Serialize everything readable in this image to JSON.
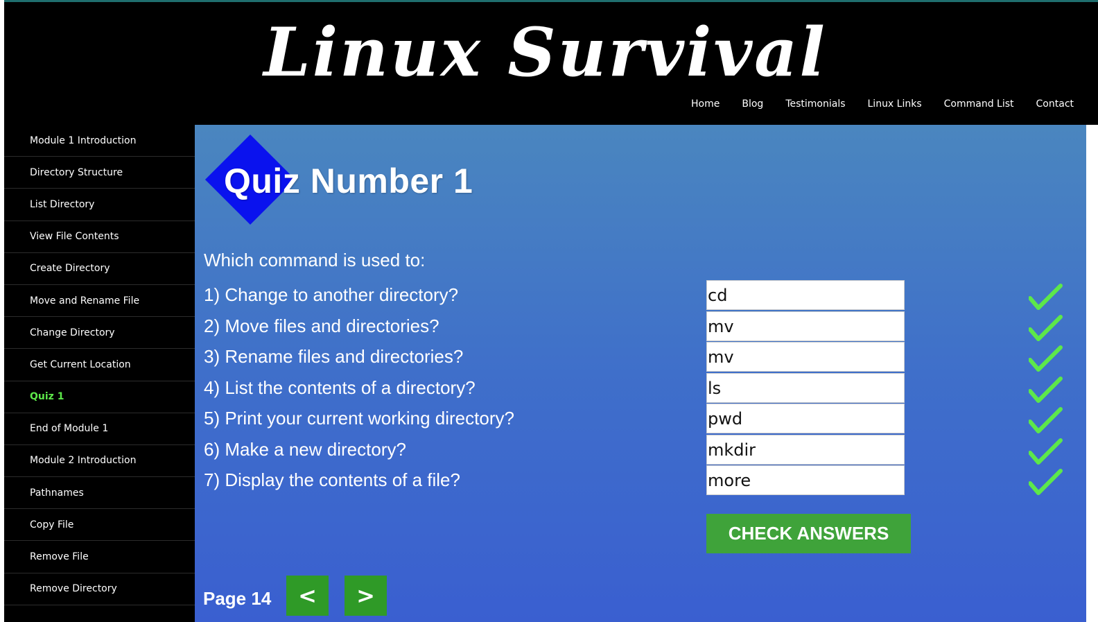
{
  "site": {
    "title": "Linux Survival"
  },
  "topnav": [
    "Home",
    "Blog",
    "Testimonials",
    "Linux Links",
    "Command List",
    "Contact"
  ],
  "sidebar": {
    "items": [
      {
        "label": "Module 1 Introduction"
      },
      {
        "label": "Directory Structure"
      },
      {
        "label": "List Directory"
      },
      {
        "label": "View File Contents"
      },
      {
        "label": "Create Directory"
      },
      {
        "label": "Move and Rename File"
      },
      {
        "label": "Change Directory"
      },
      {
        "label": "Get Current Location"
      },
      {
        "label": "Quiz 1",
        "active": true
      },
      {
        "label": "End of Module 1"
      },
      {
        "label": "Module 2 Introduction"
      },
      {
        "label": "Pathnames"
      },
      {
        "label": "Copy File"
      },
      {
        "label": "Remove File"
      },
      {
        "label": "Remove Directory"
      }
    ]
  },
  "main": {
    "quiz_title": "Quiz Number 1",
    "intro": "Which command is used to:",
    "questions": [
      {
        "text": "1) Change to another directory?",
        "answer": "cd",
        "icon": "checkmark-icon"
      },
      {
        "text": "2) Move files and directories?",
        "answer": "mv",
        "icon": "checkmark-icon"
      },
      {
        "text": "3) Rename files and directories?",
        "answer": "mv",
        "icon": "checkmark-icon"
      },
      {
        "text": "4) List the contents of a directory?",
        "answer": "ls",
        "icon": "checkmark-icon"
      },
      {
        "text": "5) Print your current working directory?",
        "answer": "pwd",
        "icon": "checkmark-icon"
      },
      {
        "text": "6) Make a new directory?",
        "answer": "mkdir",
        "icon": "checkmark-icon"
      },
      {
        "text": "7) Display the contents of a file?",
        "answer": "more",
        "icon": "checkmark-icon"
      }
    ],
    "check_button": "CHECK ANSWERS",
    "page_label": "Page 14",
    "prev_label": "<",
    "next_label": ">"
  },
  "colors": {
    "accent_green": "#3fa33a",
    "active_sidebar": "#5de84a",
    "check_green": "#5de84a",
    "logo_blue": "#0a12ee"
  }
}
